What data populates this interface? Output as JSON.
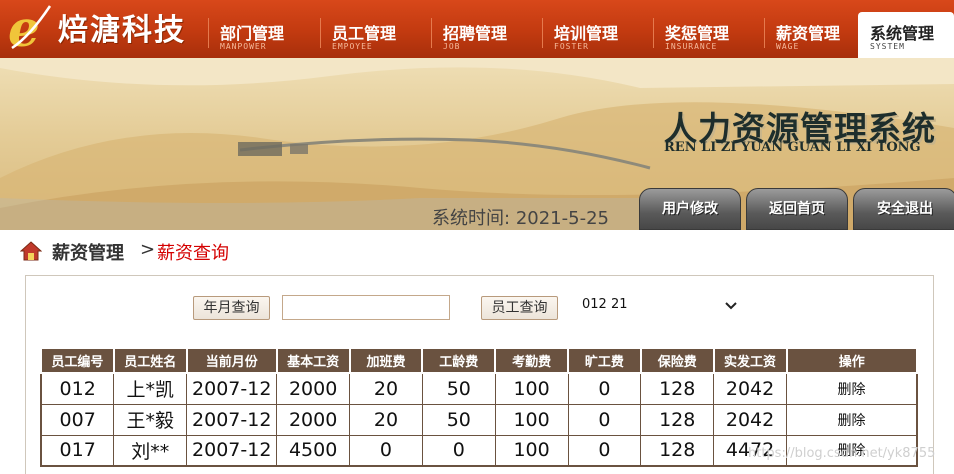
{
  "brand": {
    "logo_letter": "e",
    "name": "焙溏科技"
  },
  "nav": {
    "items": [
      {
        "cn": "部门管理",
        "en": "MANPOWER"
      },
      {
        "cn": "员工管理",
        "en": "EMPOYEE"
      },
      {
        "cn": "招聘管理",
        "en": "JOB"
      },
      {
        "cn": "培训管理",
        "en": "FOSTER"
      },
      {
        "cn": "奖惩管理",
        "en": "INSURANCE"
      },
      {
        "cn": "薪资管理",
        "en": "WAGE"
      },
      {
        "cn": "系统管理",
        "en": "SYSTEM",
        "active": true
      }
    ]
  },
  "banner": {
    "title": "人力资源管理系统",
    "pinyin": "REN LI ZI YUAN GUAN LI XI TONG",
    "time_label": "系统时间:",
    "time_value": "2021-5-25",
    "buttons": [
      "用户修改",
      "返回首页",
      "安全退出"
    ]
  },
  "breadcrumb": {
    "parent": "薪资管理",
    "separator": ">",
    "current": "薪资查询"
  },
  "query": {
    "month_button": "年月查询",
    "month_input_value": "",
    "employee_button": "员工查询",
    "employee_select_value": "012  21"
  },
  "table": {
    "columns": [
      "员工编号",
      "员工姓名",
      "当前月份",
      "基本工资",
      "加班费",
      "工龄费",
      "考勤费",
      "旷工费",
      "保险费",
      "实发工资",
      "操作"
    ],
    "rows": [
      [
        "012",
        "上*凯",
        "2007-12",
        "2000",
        "20",
        "50",
        "100",
        "0",
        "128",
        "2042",
        "删除"
      ],
      [
        "007",
        "王*毅",
        "2007-12",
        "2000",
        "20",
        "50",
        "100",
        "0",
        "128",
        "2042",
        "删除"
      ],
      [
        "017",
        "刘**",
        "2007-12",
        "4500",
        "0",
        "0",
        "100",
        "0",
        "128",
        "4472",
        "删除"
      ]
    ]
  },
  "watermark": "https://blog.csdn.net/yk8755",
  "colors": {
    "nav_orange": "#c23a10",
    "table_header": "#6a5240",
    "crumb_current": "#d40000"
  }
}
